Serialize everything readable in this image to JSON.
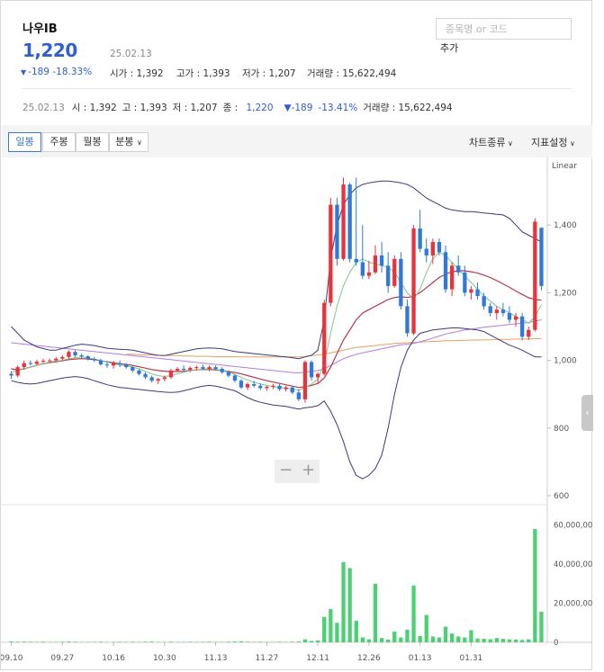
{
  "header": {
    "stock_name": "나우IB",
    "price": "1,220",
    "price_date": "25.02.13",
    "change": "-189",
    "change_pct": "-18.33%",
    "open_label": "시가 : ",
    "open": "1,392",
    "high_label": "고가 : ",
    "high": "1,393",
    "low_label": "저가 : ",
    "low": "1,207",
    "volume_label": "거래량 : ",
    "volume": "15,622,494"
  },
  "search": {
    "placeholder": "종목명 or 코드",
    "add_label": "추가"
  },
  "info_row": {
    "date": "25.02.13",
    "open": "시 : 1,392",
    "high": "고 : 1,393",
    "low": "저 : 1,207",
    "close_label": "종 : ",
    "close": "1,220",
    "change": "▼-189",
    "change_pct": "-13.41%",
    "volume": "거래량 : 15,622,494"
  },
  "toolbar": {
    "periods": [
      "일봉",
      "주봉",
      "월봉",
      "분봉"
    ],
    "active_period": "일봉",
    "chart_type_label": "차트종류",
    "indicator_label": "지표설정"
  },
  "colors": {
    "up": "#e8333c",
    "down": "#2f79d9",
    "bollinger": "#3a3a7a",
    "ma_short": "#7cc98a",
    "ma_mid": "#b5384a",
    "ma_long": "#b57be0",
    "ma_vlong": "#e8a060",
    "volume_bar": "#4cd073"
  },
  "chart_data": [
    {
      "type": "candlestick",
      "scale_label": "Linear",
      "y_ticks": [
        600,
        800,
        1000,
        1200,
        1400
      ],
      "ylim": [
        600,
        1600
      ],
      "x_tick_labels": [
        "09.10",
        "09.27",
        "10.16",
        "10.30",
        "11.13",
        "11.27",
        "12.11",
        "12.26",
        "01.13",
        "01.31"
      ],
      "candles": [
        [
          960,
          968,
          945,
          955
        ],
        [
          955,
          985,
          950,
          980
        ],
        [
          980,
          1000,
          972,
          992
        ],
        [
          992,
          1000,
          985,
          990
        ],
        [
          990,
          1002,
          986,
          996
        ],
        [
          996,
          1005,
          990,
          999
        ],
        [
          999,
          1005,
          995,
          1000
        ],
        [
          1000,
          1010,
          998,
          1005
        ],
        [
          1005,
          1015,
          1000,
          1010
        ],
        [
          1010,
          1030,
          1005,
          1025
        ],
        [
          1025,
          1030,
          1010,
          1015
        ],
        [
          1015,
          1020,
          1005,
          1012
        ],
        [
          1012,
          1015,
          1000,
          1004
        ],
        [
          1004,
          1010,
          995,
          1000
        ],
        [
          1000,
          1005,
          985,
          988
        ],
        [
          988,
          995,
          978,
          985
        ],
        [
          985,
          998,
          975,
          992
        ],
        [
          992,
          1000,
          980,
          988
        ],
        [
          988,
          992,
          975,
          980
        ],
        [
          980,
          985,
          965,
          970
        ],
        [
          970,
          975,
          955,
          960
        ],
        [
          960,
          965,
          945,
          950
        ],
        [
          950,
          955,
          935,
          940
        ],
        [
          940,
          948,
          930,
          945
        ],
        [
          945,
          955,
          938,
          950
        ],
        [
          950,
          975,
          945,
          970
        ],
        [
          970,
          980,
          965,
          975
        ],
        [
          975,
          985,
          968,
          972
        ],
        [
          972,
          982,
          965,
          978
        ],
        [
          978,
          985,
          970,
          980
        ],
        [
          980,
          988,
          972,
          975
        ],
        [
          975,
          985,
          968,
          980
        ],
        [
          980,
          985,
          970,
          975
        ],
        [
          975,
          980,
          960,
          965
        ],
        [
          965,
          970,
          950,
          955
        ],
        [
          955,
          960,
          935,
          940
        ],
        [
          940,
          945,
          915,
          920
        ],
        [
          920,
          935,
          912,
          930
        ],
        [
          930,
          940,
          920,
          925
        ],
        [
          925,
          932,
          912,
          918
        ],
        [
          918,
          925,
          910,
          922
        ],
        [
          922,
          930,
          915,
          925
        ],
        [
          925,
          930,
          910,
          915
        ],
        [
          915,
          925,
          908,
          920
        ],
        [
          920,
          925,
          900,
          905
        ],
        [
          905,
          915,
          880,
          885
        ],
        [
          885,
          1000,
          875,
          995
        ],
        [
          995,
          1000,
          940,
          950
        ],
        [
          950,
          965,
          930,
          960
        ],
        [
          960,
          1180,
          955,
          1170
        ],
        [
          1170,
          1480,
          1160,
          1460
        ],
        [
          1460,
          1480,
          1280,
          1300
        ],
        [
          1300,
          1540,
          1295,
          1520
        ],
        [
          1520,
          1525,
          1290,
          1300
        ],
        [
          1300,
          1540,
          1280,
          1290
        ],
        [
          1290,
          1400,
          1240,
          1250
        ],
        [
          1250,
          1295,
          1240,
          1260
        ],
        [
          1260,
          1340,
          1255,
          1310
        ],
        [
          1310,
          1350,
          1260,
          1280
        ],
        [
          1280,
          1320,
          1200,
          1220
        ],
        [
          1220,
          1310,
          1215,
          1300
        ],
        [
          1300,
          1320,
          1150,
          1160
        ],
        [
          1160,
          1180,
          1070,
          1080
        ],
        [
          1080,
          1400,
          1075,
          1390
        ],
        [
          1390,
          1445,
          1320,
          1330
        ],
        [
          1330,
          1360,
          1290,
          1310
        ],
        [
          1310,
          1360,
          1285,
          1350
        ],
        [
          1350,
          1360,
          1310,
          1320
        ],
        [
          1320,
          1340,
          1200,
          1210
        ],
        [
          1210,
          1290,
          1190,
          1280
        ],
        [
          1280,
          1310,
          1250,
          1260
        ],
        [
          1260,
          1280,
          1190,
          1200
        ],
        [
          1200,
          1220,
          1180,
          1210
        ],
        [
          1210,
          1230,
          1180,
          1190
        ],
        [
          1190,
          1200,
          1150,
          1160
        ],
        [
          1160,
          1170,
          1130,
          1140
        ],
        [
          1140,
          1160,
          1120,
          1150
        ],
        [
          1150,
          1170,
          1130,
          1140
        ],
        [
          1140,
          1160,
          1110,
          1120
        ],
        [
          1120,
          1140,
          1100,
          1130
        ],
        [
          1130,
          1140,
          1060,
          1070
        ],
        [
          1070,
          1100,
          1060,
          1090
        ],
        [
          1090,
          1420,
          1085,
          1410
        ],
        [
          1392,
          1393,
          1207,
          1220
        ]
      ],
      "bollinger_upper": [
        1100,
        1080,
        1060,
        1050,
        1040,
        1035,
        1030,
        1030,
        1035,
        1040,
        1045,
        1048,
        1046,
        1044,
        1040,
        1036,
        1034,
        1033,
        1032,
        1030,
        1026,
        1022,
        1018,
        1015,
        1014,
        1018,
        1022,
        1026,
        1030,
        1034,
        1036,
        1037,
        1036,
        1034,
        1030,
        1026,
        1024,
        1022,
        1020,
        1018,
        1016,
        1014,
        1012,
        1010,
        1008,
        1005,
        1010,
        1015,
        1030,
        1120,
        1300,
        1400,
        1460,
        1490,
        1510,
        1520,
        1525,
        1528,
        1530,
        1530,
        1528,
        1525,
        1520,
        1510,
        1495,
        1480,
        1470,
        1460,
        1450,
        1445,
        1442,
        1440,
        1440,
        1438,
        1436,
        1434,
        1432,
        1430,
        1420,
        1400,
        1380,
        1370,
        1360,
        1350
      ],
      "bollinger_lower": [
        940,
        935,
        932,
        930,
        932,
        936,
        940,
        944,
        948,
        950,
        952,
        950,
        946,
        940,
        934,
        928,
        924,
        920,
        918,
        916,
        914,
        912,
        910,
        908,
        906,
        905,
        906,
        910,
        915,
        920,
        924,
        926,
        924,
        920,
        915,
        910,
        900,
        890,
        882,
        876,
        872,
        868,
        866,
        864,
        860,
        856,
        860,
        862,
        866,
        880,
        850,
        810,
        760,
        700,
        660,
        650,
        660,
        680,
        720,
        800,
        900,
        980,
        1030,
        1060,
        1080,
        1085,
        1090,
        1092,
        1094,
        1096,
        1096,
        1094,
        1092,
        1090,
        1085,
        1075,
        1065,
        1055,
        1045,
        1038,
        1030,
        1020,
        1010,
        1010
      ],
      "ma_short": [
        965,
        970,
        975,
        980,
        985,
        990,
        995,
        998,
        1000,
        1005,
        1008,
        1010,
        1008,
        1004,
        1000,
        995,
        990,
        986,
        984,
        980,
        975,
        968,
        960,
        955,
        952,
        955,
        960,
        965,
        970,
        972,
        974,
        975,
        974,
        970,
        965,
        958,
        950,
        942,
        935,
        930,
        926,
        922,
        920,
        918,
        916,
        912,
        920,
        930,
        945,
        990,
        1080,
        1160,
        1220,
        1260,
        1290,
        1300,
        1290,
        1285,
        1280,
        1275,
        1260,
        1230,
        1200,
        1180,
        1210,
        1260,
        1300,
        1320,
        1310,
        1290,
        1270,
        1250,
        1230,
        1210,
        1190,
        1175,
        1160,
        1150,
        1140,
        1130,
        1120,
        1110,
        1130,
        1165
      ],
      "ma_mid": [
        975,
        972,
        975,
        980,
        985,
        990,
        993,
        996,
        999,
        1002,
        1004,
        1005,
        1004,
        1002,
        999,
        996,
        993,
        990,
        988,
        985,
        981,
        977,
        973,
        970,
        968,
        967,
        967,
        968,
        970,
        972,
        973,
        973,
        972,
        970,
        967,
        964,
        960,
        955,
        950,
        945,
        940,
        936,
        932,
        928,
        924,
        920,
        922,
        926,
        932,
        948,
        980,
        1020,
        1060,
        1090,
        1120,
        1140,
        1150,
        1160,
        1170,
        1180,
        1186,
        1188,
        1186,
        1190,
        1200,
        1215,
        1230,
        1245,
        1255,
        1262,
        1265,
        1265,
        1262,
        1258,
        1252,
        1245,
        1236,
        1226,
        1216,
        1205,
        1195,
        1185,
        1180,
        1178
      ],
      "ma_long": [
        1052,
        1050,
        1048,
        1046,
        1044,
        1042,
        1040,
        1038,
        1036,
        1034,
        1032,
        1030,
        1028,
        1026,
        1024,
        1022,
        1020,
        1018,
        1016,
        1014,
        1012,
        1010,
        1008,
        1006,
        1004,
        1002,
        1000,
        998,
        996,
        994,
        992,
        990,
        988,
        986,
        984,
        982,
        980,
        978,
        976,
        974,
        972,
        970,
        968,
        966,
        964,
        963,
        965,
        968,
        970,
        975,
        985,
        995,
        1005,
        1012,
        1018,
        1022,
        1026,
        1030,
        1034,
        1038,
        1042,
        1046,
        1048,
        1050,
        1055,
        1060,
        1066,
        1072,
        1078,
        1082,
        1086,
        1090,
        1092,
        1095,
        1098,
        1100,
        1102,
        1104,
        1106,
        1108,
        1110,
        1112,
        1116,
        1120
      ],
      "ma_vlong": [
        null,
        null,
        null,
        null,
        null,
        null,
        null,
        null,
        null,
        null,
        null,
        null,
        null,
        null,
        null,
        null,
        null,
        null,
        1018,
        1018,
        1017,
        1016,
        1016,
        1015,
        1015,
        1014,
        1014,
        1013,
        1013,
        1012,
        1012,
        1012,
        1011,
        1011,
        1011,
        1011,
        1010,
        1010,
        1010,
        1010,
        1010,
        1010,
        1010,
        1010,
        1010,
        1010,
        1012,
        1014,
        1016,
        1018,
        1022,
        1026,
        1030,
        1034,
        1038,
        1040,
        1042,
        1044,
        1046,
        1048,
        1050,
        1051,
        1052,
        1053,
        1054,
        1055,
        1056,
        1057,
        1058,
        1058,
        1059,
        1059,
        1060,
        1060,
        1061,
        1061,
        1062,
        1062,
        1062,
        1063,
        1063,
        1063,
        1064,
        1064
      ],
      "volume_axis_ticks": [
        "0",
        "20,000,000",
        "40,000,000",
        "60,000,000"
      ],
      "volume_ylim": [
        0,
        64000000
      ],
      "volumes": [
        400000,
        300000,
        350000,
        300000,
        250000,
        300000,
        200000,
        250000,
        300000,
        400000,
        300000,
        250000,
        200000,
        250000,
        300000,
        200000,
        250000,
        300000,
        200000,
        300000,
        250000,
        300000,
        350000,
        200000,
        250000,
        300000,
        200000,
        250000,
        300000,
        200000,
        250000,
        300000,
        200000,
        250000,
        300000,
        400000,
        500000,
        300000,
        250000,
        300000,
        200000,
        250000,
        300000,
        200000,
        300000,
        400000,
        1500000,
        700000,
        900000,
        13000000,
        17000000,
        10000000,
        41000000,
        38000000,
        11000000,
        2500000,
        1500000,
        30000000,
        2200000,
        1400000,
        5500000,
        2500000,
        6500000,
        29000000,
        3200000,
        14000000,
        3000000,
        2500000,
        8000000,
        4500000,
        3000000,
        2500000,
        6200000,
        2000000,
        1800000,
        1600000,
        2200000,
        1800000,
        1500000,
        1400000,
        1200000,
        1500000,
        58000000,
        15622494
      ]
    }
  ]
}
